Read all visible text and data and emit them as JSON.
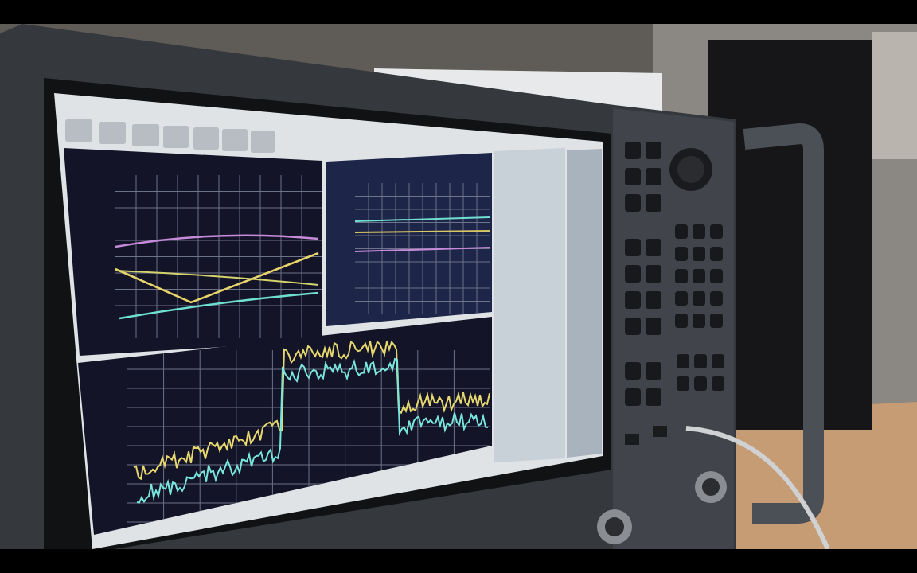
{
  "video_frame": {
    "kind": "photo"
  }
}
